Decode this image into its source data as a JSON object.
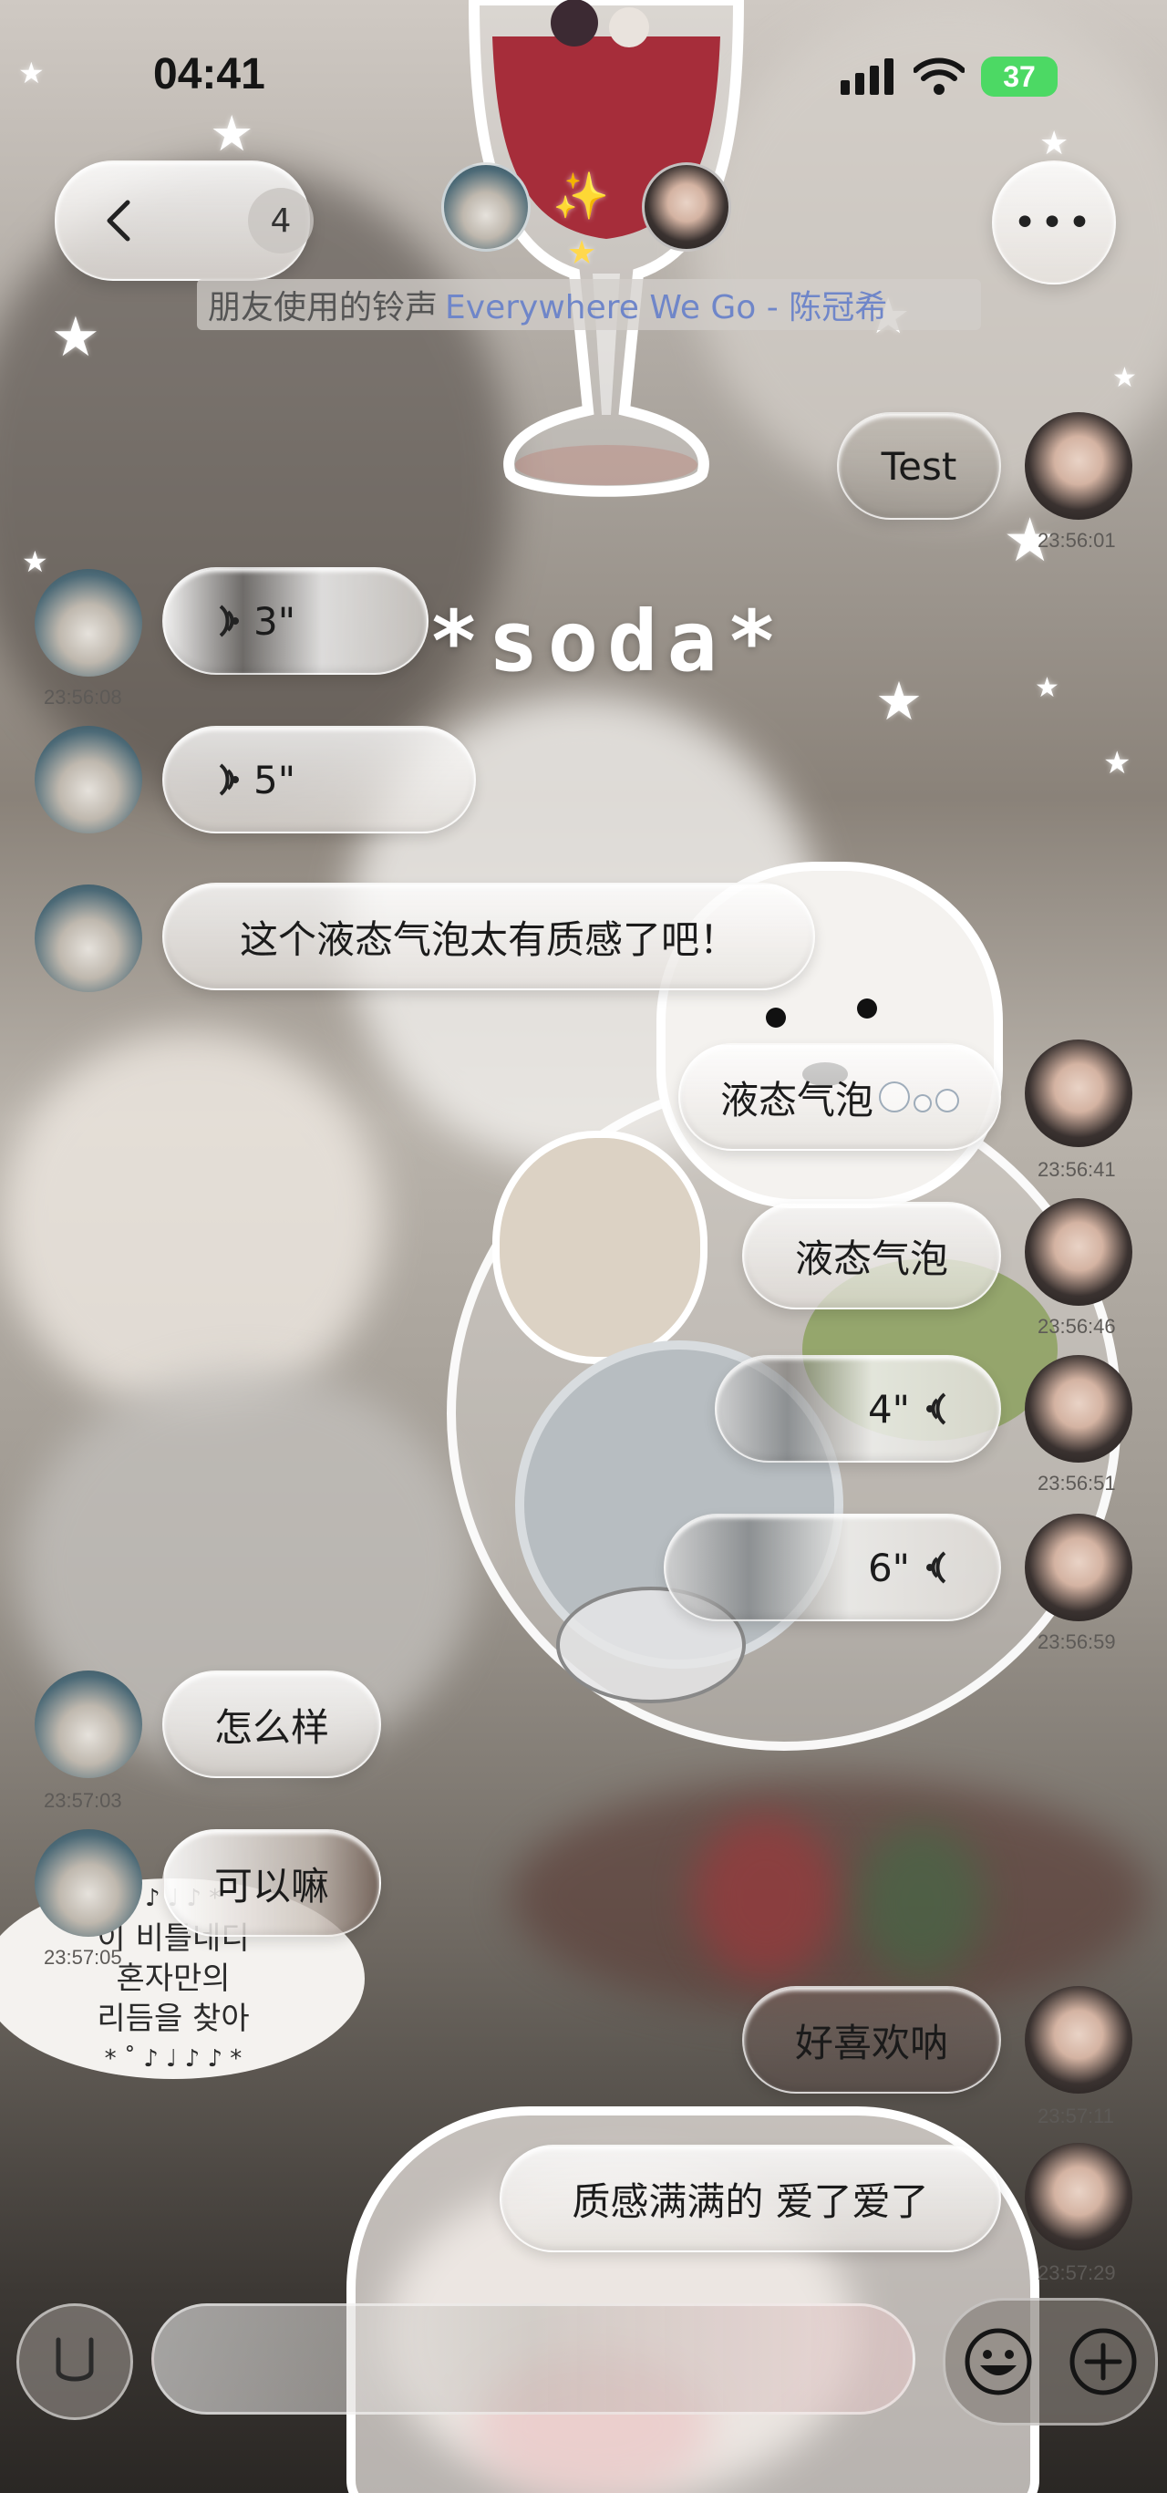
{
  "status_bar": {
    "time": "04:41",
    "battery": "37"
  },
  "header": {
    "back_label": "‹",
    "unread_count": "4",
    "more_label": "•••",
    "ringtone_label": "朋友使用的铃声",
    "ringtone_song": "Everywhere We Go - 陈冠希"
  },
  "background": {
    "sticker_text": "*soda*",
    "korean_lines": [
      "이 비틀네디",
      "혼자만의",
      "리듬을 찾아"
    ]
  },
  "messages": [
    {
      "side": "right",
      "kind": "text",
      "text": "Test",
      "time": "23:56:01"
    },
    {
      "side": "left",
      "kind": "voice",
      "duration": "3\"",
      "time": "23:56:08"
    },
    {
      "side": "left",
      "kind": "voice",
      "duration": "5\"",
      "time": ""
    },
    {
      "side": "left",
      "kind": "text",
      "text": "这个液态气泡太有质感了吧！",
      "time": ""
    },
    {
      "side": "right",
      "kind": "text",
      "text": "液态气泡",
      "time": "23:56:41"
    },
    {
      "side": "right",
      "kind": "text",
      "text": "液态气泡",
      "time": "23:56:46"
    },
    {
      "side": "right",
      "kind": "voice",
      "duration": "4\"",
      "time": "23:56:51"
    },
    {
      "side": "right",
      "kind": "voice",
      "duration": "6\"",
      "time": "23:56:59"
    },
    {
      "side": "left",
      "kind": "text",
      "text": "怎么样",
      "time": "23:57:03"
    },
    {
      "side": "left",
      "kind": "text",
      "text": "可以嘛",
      "time": "23:57:05"
    },
    {
      "side": "right",
      "kind": "text",
      "text": "好喜欢呐",
      "time": "23:57:11"
    },
    {
      "side": "right",
      "kind": "text",
      "text": "质感满满的 爱了爱了",
      "time": "23:57:29"
    }
  ],
  "input_bar": {
    "placeholder": ""
  },
  "colors": {
    "accent_green": "#4cd964",
    "link_blue": "#6f86c9"
  },
  "icons": [
    "back-chevron-icon",
    "more-icon",
    "signal-icon",
    "wifi-icon",
    "battery-icon",
    "voice-wave-icon",
    "emoji-icon",
    "plus-icon",
    "voice-toggle-icon",
    "sparkle-icon"
  ]
}
